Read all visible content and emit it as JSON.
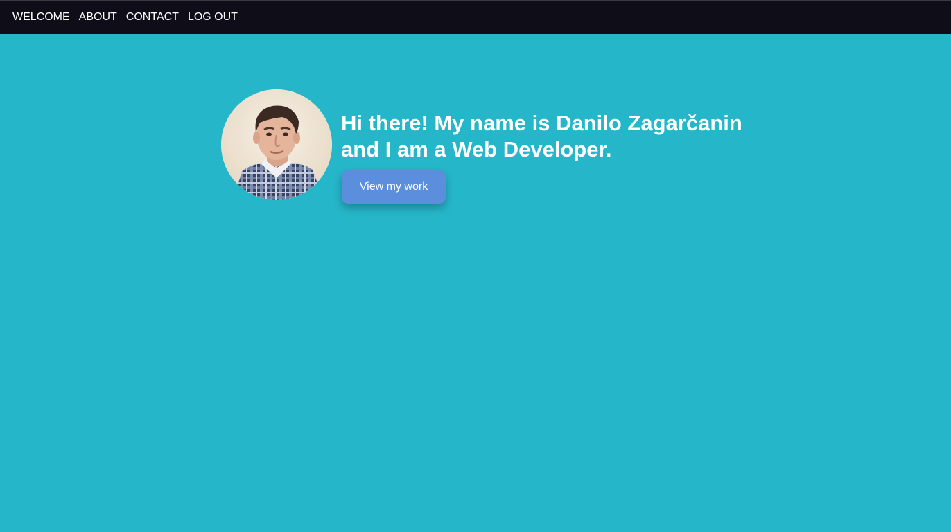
{
  "nav": {
    "items": [
      {
        "label": "WELCOME"
      },
      {
        "label": "ABOUT"
      },
      {
        "label": "CONTACT"
      },
      {
        "label": "LOG OUT"
      }
    ]
  },
  "hero": {
    "headline_line1": "Hi there! My name is Danilo Zagarčanin",
    "headline_line2": "and I am a Web Developer.",
    "button_label": "View my work",
    "avatar_icon": "avatar-photo"
  },
  "colors": {
    "background": "#26b6ca",
    "nav_background": "#0f0d18",
    "button": "#5b8fdd",
    "text": "#ffffff"
  }
}
